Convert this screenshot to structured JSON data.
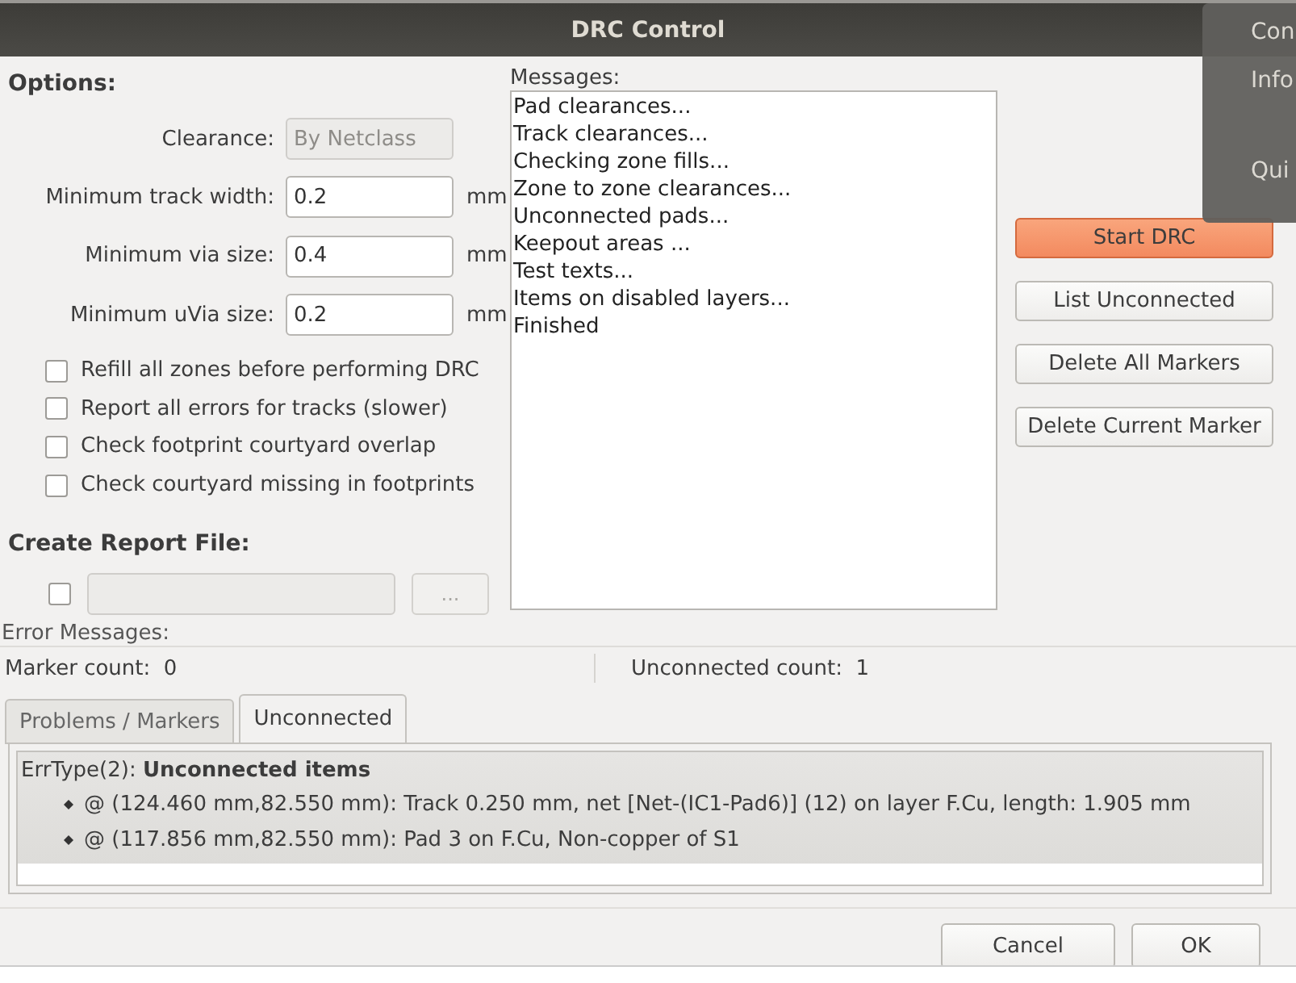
{
  "window": {
    "title": "DRC Control"
  },
  "overlay_menu": {
    "items": [
      "Con",
      "Info",
      "Qui"
    ]
  },
  "options": {
    "heading": "Options:",
    "fields": [
      {
        "label": "Clearance:",
        "value": "By Netclass",
        "disabled": true
      },
      {
        "label": "Minimum track width:",
        "value": "0.2",
        "unit": "mm",
        "disabled": false
      },
      {
        "label": "Minimum via size:",
        "value": "0.4",
        "unit": "mm",
        "disabled": false
      },
      {
        "label": "Minimum uVia size:",
        "value": "0.2",
        "unit": "mm",
        "disabled": false
      }
    ],
    "checkboxes": [
      {
        "label": "Refill all zones before performing DRC",
        "checked": false
      },
      {
        "label": "Report all errors for tracks (slower)",
        "checked": false
      },
      {
        "label": "Check footprint courtyard overlap",
        "checked": false
      },
      {
        "label": "Check courtyard missing in footprints",
        "checked": false
      }
    ]
  },
  "report": {
    "heading": "Create Report File:",
    "checked": false,
    "browse_button": "..."
  },
  "messages": {
    "label": "Messages:",
    "lines": [
      "Pad clearances...",
      "Track clearances...",
      "Checking zone fills...",
      "Zone to zone clearances...",
      "Unconnected pads...",
      "Keepout areas ...",
      "Test texts...",
      "Items on disabled layers...",
      "Finished"
    ]
  },
  "buttons": [
    {
      "label": "Start DRC",
      "primary": true
    },
    {
      "label": "List Unconnected",
      "primary": false
    },
    {
      "label": "Delete All Markers",
      "primary": false
    },
    {
      "label": "Delete Current Marker",
      "primary": false
    }
  ],
  "error_messages": {
    "label": "Error Messages:",
    "marker_count": {
      "label": "Marker count:",
      "value": "0"
    },
    "unconnected_count": {
      "label": "Unconnected count:",
      "value": "1"
    },
    "tabs": [
      {
        "label": "Problems / Markers",
        "selected": false
      },
      {
        "label": "Unconnected",
        "selected": true
      }
    ],
    "group": "ErrType(2): **Unconnected items**",
    "items": [
      "@ (124.460 mm,82.550 mm): Track 0.250 mm, net [Net-(IC1-Pad6)] (12) on layer F.Cu, length: 1.905 mm",
      "@ (117.856 mm,82.550 mm): Pad 3 on F.Cu, Non-copper of S1"
    ]
  },
  "footer_buttons": [
    "Cancel",
    "OK"
  ]
}
